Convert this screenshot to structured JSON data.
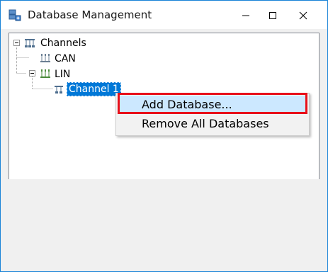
{
  "window": {
    "title": "Database Management",
    "minimize_glyph": "—",
    "maximize_glyph": "☐",
    "close_glyph": "✕"
  },
  "tree": {
    "root_label": "Channels",
    "nodes": [
      {
        "label": "CAN"
      },
      {
        "label": "LIN",
        "children": [
          {
            "label": "Channel 1",
            "selected": true
          }
        ]
      }
    ]
  },
  "context_menu": {
    "items": [
      {
        "label": "Add Database...",
        "hovered": true
      },
      {
        "label": "Remove All Databases"
      }
    ]
  },
  "colors": {
    "selection": "#0078d7",
    "menu_hover": "#cce8ff",
    "annotation": "#e8101a",
    "window_border": "#1883d7"
  },
  "icons": {
    "app": "database-add-icon",
    "root": "network-icon",
    "channel_group": "bus-icon",
    "channel": "network-node-icon"
  }
}
